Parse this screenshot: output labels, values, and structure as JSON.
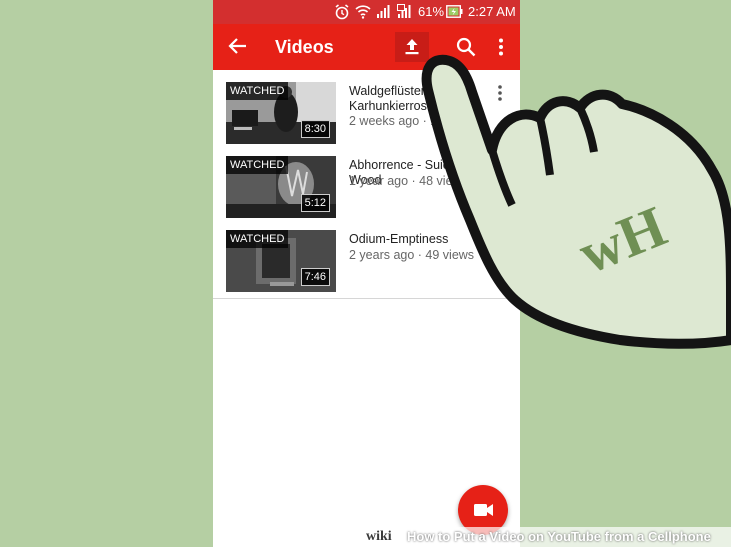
{
  "status_bar": {
    "battery": "61%",
    "time": "2:27 AM"
  },
  "app_bar": {
    "title": "Videos"
  },
  "videos": [
    {
      "watched": "WATCHED",
      "duration": "8:30",
      "title_line1": "Waldgeflüster -",
      "title_line2": "Karhunkierros Cover",
      "meta": "2 weeks ago · 16 views"
    },
    {
      "watched": "WATCHED",
      "duration": "5:12",
      "title_line1": "Abhorrence - Suicide Wood",
      "title_line2": "",
      "meta": "1 year ago · 48 views"
    },
    {
      "watched": "WATCHED",
      "duration": "7:46",
      "title_line1": "Odium-Emptiness",
      "title_line2": "",
      "meta": "2 years ago · 49 views"
    }
  ],
  "watermark": {
    "logo": "wH"
  },
  "caption": {
    "brand": "wiki",
    "text": "How to Put a Video on YouTube from a Cellphone"
  },
  "colors": {
    "youtube_red": "#e62117",
    "status_red": "#d32f2f",
    "background_green": "#b5cfa3"
  },
  "icons": [
    "alarm-icon",
    "wifi-icon",
    "signal-icon",
    "battery-charging-icon",
    "back-arrow-icon",
    "upload-icon",
    "search-icon",
    "more-vert-icon",
    "video-camera-icon",
    "pointing-hand-icon"
  ]
}
